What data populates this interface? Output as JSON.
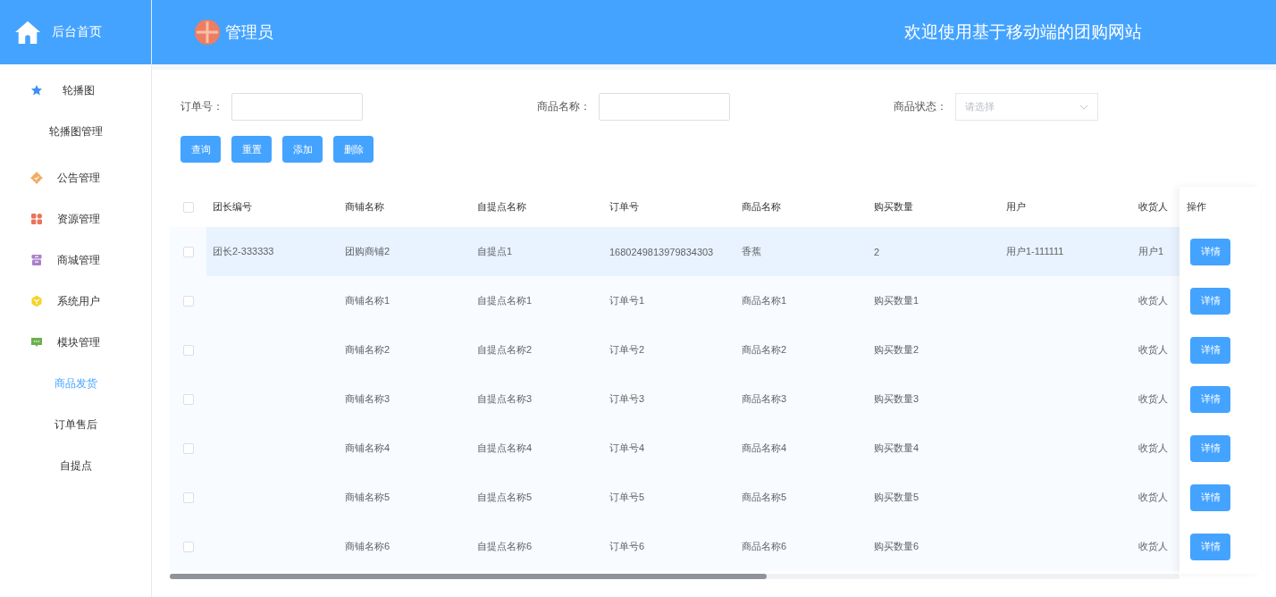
{
  "sidebar": {
    "home": "后台首页",
    "menu": [
      {
        "kind": "group",
        "label": "轮播图",
        "selected": false
      },
      {
        "kind": "item",
        "label": "轮播图管理",
        "selected": false
      },
      {
        "kind": "group",
        "label": "公告管理",
        "selected": false
      },
      {
        "kind": "group",
        "label": "资源管理",
        "selected": false
      },
      {
        "kind": "group",
        "label": "商城管理",
        "selected": false
      },
      {
        "kind": "group",
        "label": "系统用户",
        "selected": false
      },
      {
        "kind": "group",
        "label": "模块管理",
        "selected": false
      },
      {
        "kind": "item",
        "label": "商品发货",
        "selected": true
      },
      {
        "kind": "item",
        "label": "订单售后",
        "selected": false
      },
      {
        "kind": "item",
        "label": "自提点",
        "selected": false
      }
    ]
  },
  "header": {
    "user": "管理员",
    "title": "欢迎使用基于移动端的团购网站"
  },
  "filters": [
    {
      "kind": "input",
      "label": "订单号："
    },
    {
      "kind": "input",
      "label": "商品名称："
    },
    {
      "kind": "select",
      "label": "商品状态：",
      "placeholder": "请选择"
    }
  ],
  "buttons": [
    "查询",
    "重置",
    "添加",
    "删除"
  ],
  "table": {
    "columns": [
      "团长编号",
      "商铺名称",
      "自提点名称",
      "订单号",
      "商品名称",
      "购买数量",
      "用户",
      "收货人"
    ],
    "action_column": "操作",
    "all_checked": false,
    "rows": [
      {
        "highlighted": true,
        "checked": false,
        "cells": [
          "团长2-333333",
          "团购商铺2",
          "自提点1",
          "1680249813979834303",
          "香蕉",
          "2",
          "用户1-111111",
          "用户1"
        ],
        "action": "详情"
      },
      {
        "highlighted": false,
        "checked": false,
        "cells": [
          "",
          "商铺名称1",
          "自提点名称1",
          "订单号1",
          "商品名称1",
          "购买数量1",
          "",
          "收货人"
        ],
        "action": "详情"
      },
      {
        "highlighted": false,
        "checked": false,
        "cells": [
          "",
          "商铺名称2",
          "自提点名称2",
          "订单号2",
          "商品名称2",
          "购买数量2",
          "",
          "收货人"
        ],
        "action": "详情"
      },
      {
        "highlighted": false,
        "checked": false,
        "cells": [
          "",
          "商铺名称3",
          "自提点名称3",
          "订单号3",
          "商品名称3",
          "购买数量3",
          "",
          "收货人"
        ],
        "action": "详情"
      },
      {
        "highlighted": false,
        "checked": false,
        "cells": [
          "",
          "商铺名称4",
          "自提点名称4",
          "订单号4",
          "商品名称4",
          "购买数量4",
          "",
          "收货人"
        ],
        "action": "详情"
      },
      {
        "highlighted": false,
        "checked": false,
        "cells": [
          "",
          "商铺名称5",
          "自提点名称5",
          "订单号5",
          "商品名称5",
          "购买数量5",
          "",
          "收货人"
        ],
        "action": "详情"
      },
      {
        "highlighted": false,
        "checked": false,
        "cells": [
          "",
          "商铺名称6",
          "自提点名称6",
          "订单号6",
          "商品名称6",
          "购买数量6",
          "",
          "收货人"
        ],
        "action": "详情"
      }
    ]
  }
}
